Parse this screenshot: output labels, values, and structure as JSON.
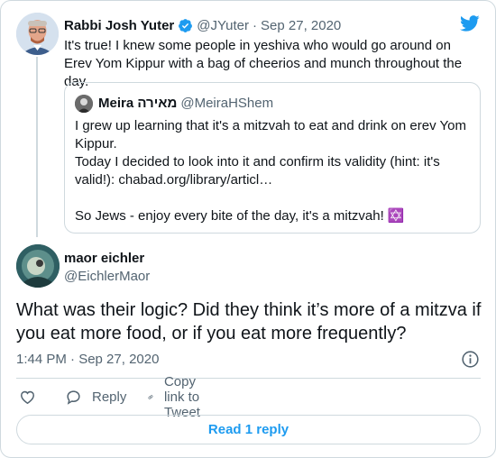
{
  "parent_tweet": {
    "author_name": "Rabbi Josh Yuter",
    "handle": "@JYuter",
    "separator": "·",
    "date": "Sep 27, 2020",
    "text": "It's true! I knew some people in yeshiva who would go around on Erev Yom Kippur with a bag of cheerios and munch throughout the day.",
    "verified_icon": "verified-badge-icon",
    "brand_icon": "twitter-bird-icon"
  },
  "quoted_tweet": {
    "author_name": "Meira מאירה",
    "handle": "@MeiraHShem",
    "lines": [
      "I grew up learning that it's a mitzvah to eat and drink on erev Yom Kippur.",
      "Today I decided to look into it and confirm its validity (hint: it's valid!): chabad.org/library/articl…",
      "",
      "So Jews - enjoy every bite of the day, it's a mitzvah! ✡️"
    ]
  },
  "main_tweet": {
    "author_name": "maor eichler",
    "handle": "@EichlerMaor",
    "text": "What was their logic? Did they think it’s more of a mitzva if you eat more food, or if you eat more frequently?",
    "time": "1:44 PM · Sep 27, 2020",
    "info_icon": "info-icon"
  },
  "actions": {
    "like_icon": "heart-icon",
    "reply_label": "Reply",
    "copy_label": "Copy link to Tweet",
    "read_replies_label": "Read 1 reply"
  },
  "colors": {
    "accent": "#1d9bf0",
    "text_primary": "#0f1419",
    "text_secondary": "#536471",
    "border": "#cfd9de"
  }
}
